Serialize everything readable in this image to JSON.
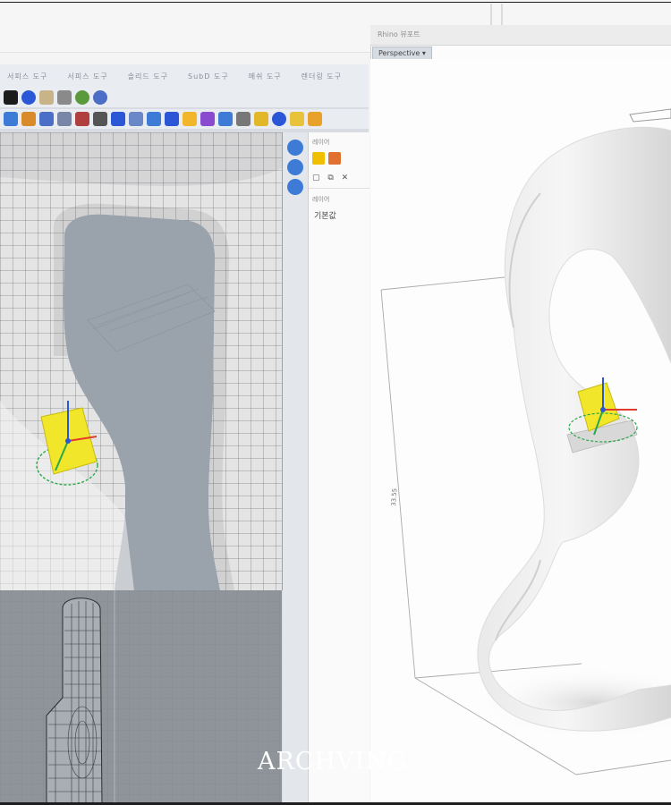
{
  "left_window": {
    "menu_tabs": [
      "서피스 도구",
      "서피스 도구",
      "솔리드 도구",
      "SubD 도구",
      "메쉬 도구",
      "렌더링 도구"
    ],
    "toolbar_row_1_icons": [
      "point-icon",
      "sphere-icon",
      "lens-icon",
      "camera-icon",
      "render-icon",
      "globe-icon"
    ],
    "toolbar_row_2_icons": [
      "grid-icon",
      "transform-icon",
      "shade-icon",
      "extrude-icon",
      "cube-icon",
      "gear-icon",
      "star-icon",
      "cloud-icon",
      "rotate-icon",
      "move-icon",
      "bolt-icon",
      "paint-icon",
      "link-icon",
      "array-icon",
      "snap-icon",
      "globe-icon",
      "lamp-icon",
      "warning-icon"
    ],
    "side_panel_icons": [
      "properties-icon",
      "layers-icon",
      "display-icon"
    ]
  },
  "layer_panel": {
    "title": "레이어",
    "list_title": "레이어",
    "list_item": "기본값"
  },
  "right_window": {
    "title": "Rhino 뷰포트",
    "viewport_tab": "Perspective ▾",
    "dimension_label": "33.55"
  },
  "watermark": "ARCHVING",
  "colors": {
    "gumball_yellow": "#f2e62a",
    "gumball_x": "#e23b2b",
    "gumball_y": "#2aa84a",
    "gumball_z": "#2b57d6",
    "viewport_bg": "#c7cbd0",
    "accent": "#3d7bd6"
  }
}
